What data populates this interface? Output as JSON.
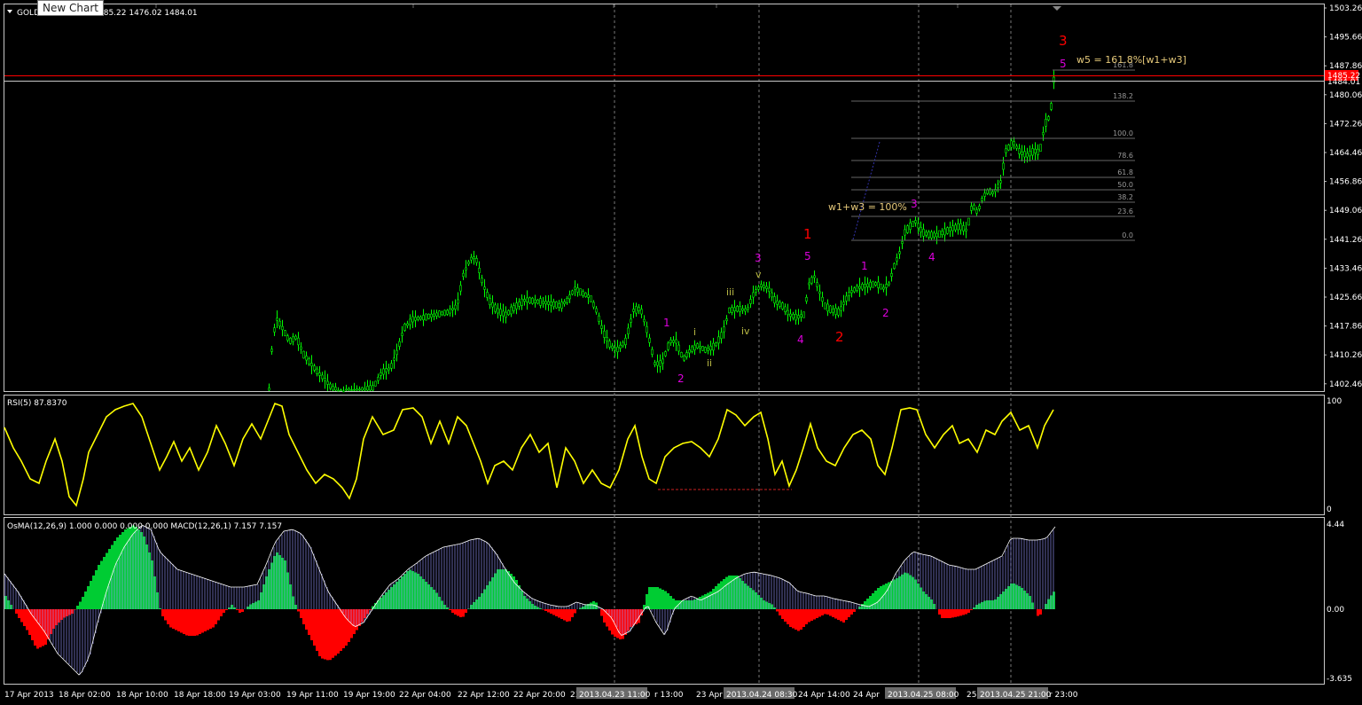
{
  "symbol": "GOLD",
  "tooltip": "New Chart",
  "ohlc_text": "485.22 1476.02 1484.01",
  "current_price": "1484.01",
  "ask_price": "1485.22",
  "colors": {
    "background": "#000000",
    "candle": "#00ff00",
    "rsi_line": "#ffff00",
    "osma_up": "#00cc33",
    "osma_down": "#ff0000",
    "macd": "#9999ff",
    "wave_primary": "#ff0000",
    "wave_minor": "#dd00dd",
    "wave_sub": "#bbbb44",
    "fib": "#666666",
    "annotation": "#e6c97a",
    "price_line": "#ff0000"
  },
  "price_axis": {
    "labels": [
      "1503.26",
      "1495.66",
      "1487.86",
      "1480.06",
      "1472.26",
      "1464.46",
      "1456.86",
      "1449.06",
      "1441.26",
      "1433.46",
      "1425.66",
      "1417.86",
      "1410.26",
      "1402.46"
    ]
  },
  "annotations": {
    "w5": "w5 = 161.8%[w1+w3]",
    "w1w3": "w1+w3 = 100%"
  },
  "fib_levels": [
    "161.8",
    "138.2",
    "100.0",
    "78.6",
    "61.8",
    "50.0",
    "38.2",
    "23.6",
    "0.0"
  ],
  "wave_labels": {
    "primary": [
      "1",
      "2",
      "3"
    ],
    "minor": [
      "1",
      "2",
      "3",
      "4",
      "5",
      "1",
      "2",
      "3",
      "4",
      "5"
    ],
    "sub": [
      "i",
      "ii",
      "iii",
      "iv",
      "v"
    ]
  },
  "rsi": {
    "label": "RSI(5) 87.8370",
    "scale_top": "100",
    "scale_bottom": "0"
  },
  "osma": {
    "label": "OsMA(12,26,9) 1.000 0.000 0.000 0.000  MACD(12,26,1) 7.157 7.157",
    "scale_top": "4.44",
    "scale_zero": "0.00",
    "scale_bottom": "-3.635"
  },
  "time_axis": {
    "labels": [
      "17 Apr 2013",
      "18 Apr 02:00",
      "18 Apr 10:00",
      "18 Apr 18:00",
      "19 Apr 03:00",
      "19 Apr 11:00",
      "19 Apr 19:00",
      "22 Apr 04:00",
      "22 Apr 12:00",
      "22 Apr 20:00",
      "23",
      "r 13:00",
      "23 Apr 21:",
      "24 Apr 14:00",
      "24 Apr",
      "25",
      "r 23:00"
    ],
    "highlights": [
      "2013.04.23 11:00",
      "2013.04.24 08:30",
      "2013.04.25 08:00",
      "2013.04.25 21:00"
    ]
  }
}
